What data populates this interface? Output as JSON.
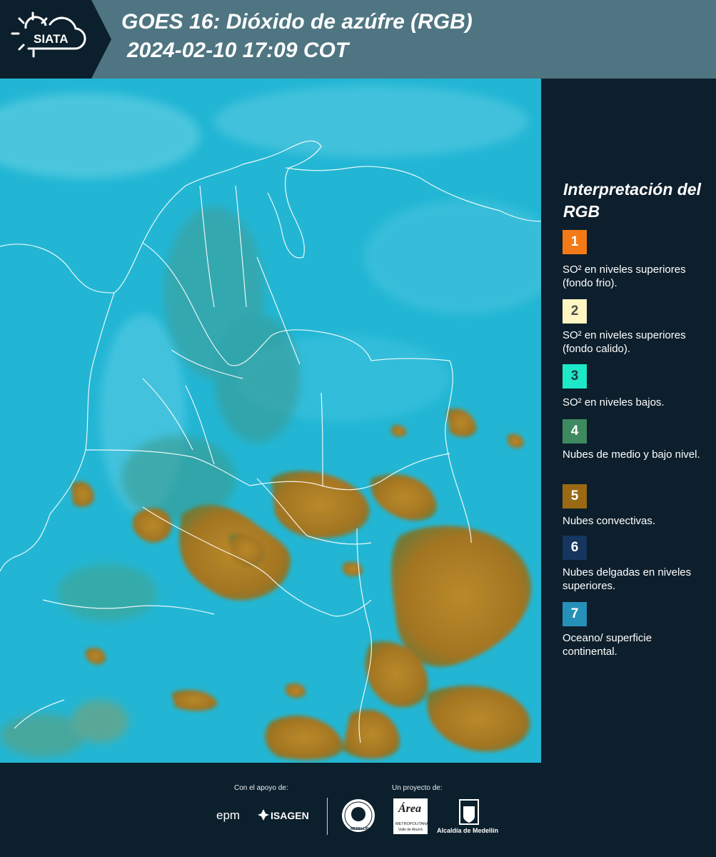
{
  "header": {
    "logo_text": "SIATA",
    "title_line1": "GOES 16: Dióxido de azúfre (RGB)",
    "title_line2": "2024-02-10 17:09 COT"
  },
  "legend": {
    "title": "Interpretación del RGB",
    "items": [
      {
        "number": "1",
        "color": "#f47a17",
        "text_color": "#ffffff",
        "label": "SO² en niveles superiores (fondo frio)."
      },
      {
        "number": "2",
        "color": "#fdf6c3",
        "text_color": "#4a4a4a",
        "label": "SO² en niveles superiores (fondo calido)."
      },
      {
        "number": "3",
        "color": "#1de8c7",
        "text_color": "#1b3a3a",
        "label": "SO² en niveles bajos."
      },
      {
        "number": "4",
        "color": "#3e8a60",
        "text_color": "#ffffff",
        "label": "Nubes de medio y bajo nivel."
      },
      {
        "number": "5",
        "color": "#9a6914",
        "text_color": "#ffffff",
        "label": "Nubes convectivas."
      },
      {
        "number": "6",
        "color": "#16355f",
        "text_color": "#ffffff",
        "label": "Nubes delgadas en niveles superiores."
      },
      {
        "number": "7",
        "color": "#2590b8",
        "text_color": "#ffffff",
        "label": "Oceano/ superficie continental."
      }
    ]
  },
  "footer": {
    "support_label": "Con el apoyo de:",
    "project_label": "Un proyecto de:",
    "sponsor_1": "epm",
    "sponsor_2": "ISAGEN",
    "partner_area_line1": "Área",
    "partner_area_line2": "METROPOLITANA",
    "partner_area_line3": "Valle de Aburrá",
    "partner_alcaldia": "Alcaldía de Medellín",
    "seal_text": "MEDELLÍN"
  },
  "colors": {
    "header_bg": "#4f7582",
    "panel_bg": "#0d1f2c",
    "ocean": "#22b6d4",
    "convective": "#a67a22"
  }
}
